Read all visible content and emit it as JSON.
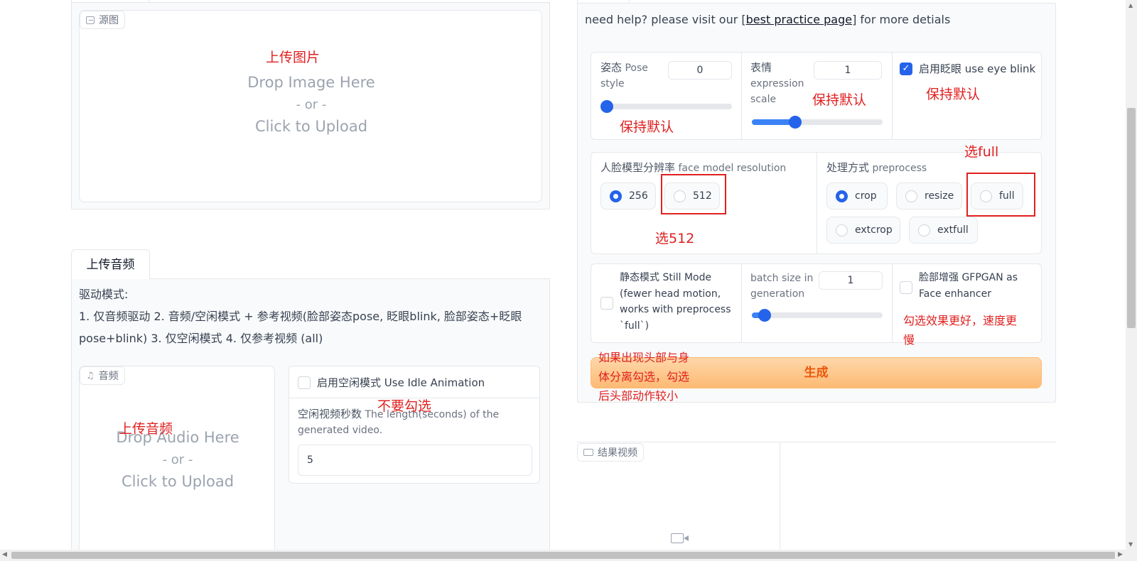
{
  "source_image": {
    "tag_label": "源图",
    "drop_main": "Drop Image Here",
    "drop_or": "- or -",
    "drop_click": "Click to Upload"
  },
  "audio_tab": {
    "label": "上传音频"
  },
  "drive_mode": {
    "line1": "驱动模式:",
    "line2": "1. 仅音频驱动 2. 音频/空闲模式 + 参考视频(脸部姿态pose, 眨眼blink, 脸部姿态+眨眼",
    "line3": "pose+blink) 3. 仅空闲模式 4. 仅参考视频 (all)"
  },
  "audio": {
    "tag_label": "音频",
    "drop_main": "Drop Audio Here",
    "drop_or": "- or -",
    "drop_click": "Click to Upload"
  },
  "idle": {
    "checkbox_label": "启用空闲模式 Use Idle Animation",
    "checked": false,
    "seconds_label_zh": "空闲视频秒数",
    "seconds_label_en": "The length(seconds) of the generated video.",
    "seconds_value": "5"
  },
  "help": {
    "prefix": "need help? please visit our [",
    "link": "best practice page",
    "suffix": "] for more detials"
  },
  "pose": {
    "label_zh": "姿态",
    "label_en1": "Pose",
    "label_en2": "style",
    "value": "0",
    "level": 0
  },
  "expression": {
    "label_zh": "表情",
    "label_en1": "expression",
    "label_en2": "scale",
    "value": "1",
    "level": 0.33
  },
  "eye_blink": {
    "label": "启用眨眼 use eye blink",
    "checked": true
  },
  "face_res": {
    "label_zh": "人脸模型分辨率",
    "label_en": "face model resolution",
    "options": [
      "256",
      "512"
    ],
    "selected": "256"
  },
  "preprocess": {
    "label_zh": "处理方式",
    "label_en": "preprocess",
    "options": [
      "crop",
      "resize",
      "full",
      "extcrop",
      "extfull"
    ],
    "selected": "crop"
  },
  "still_mode": {
    "line1": "静态模式 Still Mode",
    "line2": "(fewer head motion,",
    "line3": "works with preprocess",
    "line4": "`full`)",
    "checked": false
  },
  "batch": {
    "label1": "batch size in",
    "label2": "generation",
    "value": "1",
    "level": 0.1
  },
  "gfpgan": {
    "line1": "脸部增强 GFPGAN as",
    "line2": "Face enhancer",
    "checked": false
  },
  "generate_button": {
    "label": "生成"
  },
  "result": {
    "tag_label": "结果视频"
  },
  "annotations": {
    "upload_image": "上传图片",
    "keep_default_1": "保持默认",
    "keep_default_2": "保持默认",
    "keep_default_3": "保持默认",
    "choose_full": "选full",
    "choose_512": "选512",
    "enhance_note_1": "勾选效果更好，速度更",
    "enhance_note_2": "慢",
    "head_note_1": "如果出现头部与身",
    "head_note_2": "体分离勾选，勾选",
    "head_note_3": "后头部动作较小",
    "dont_check": "不要勾选",
    "upload_audio": "上传音频"
  },
  "colors": {
    "accent": "#2563eb",
    "annotation": "#e02020",
    "generate_text": "#ea580c"
  }
}
